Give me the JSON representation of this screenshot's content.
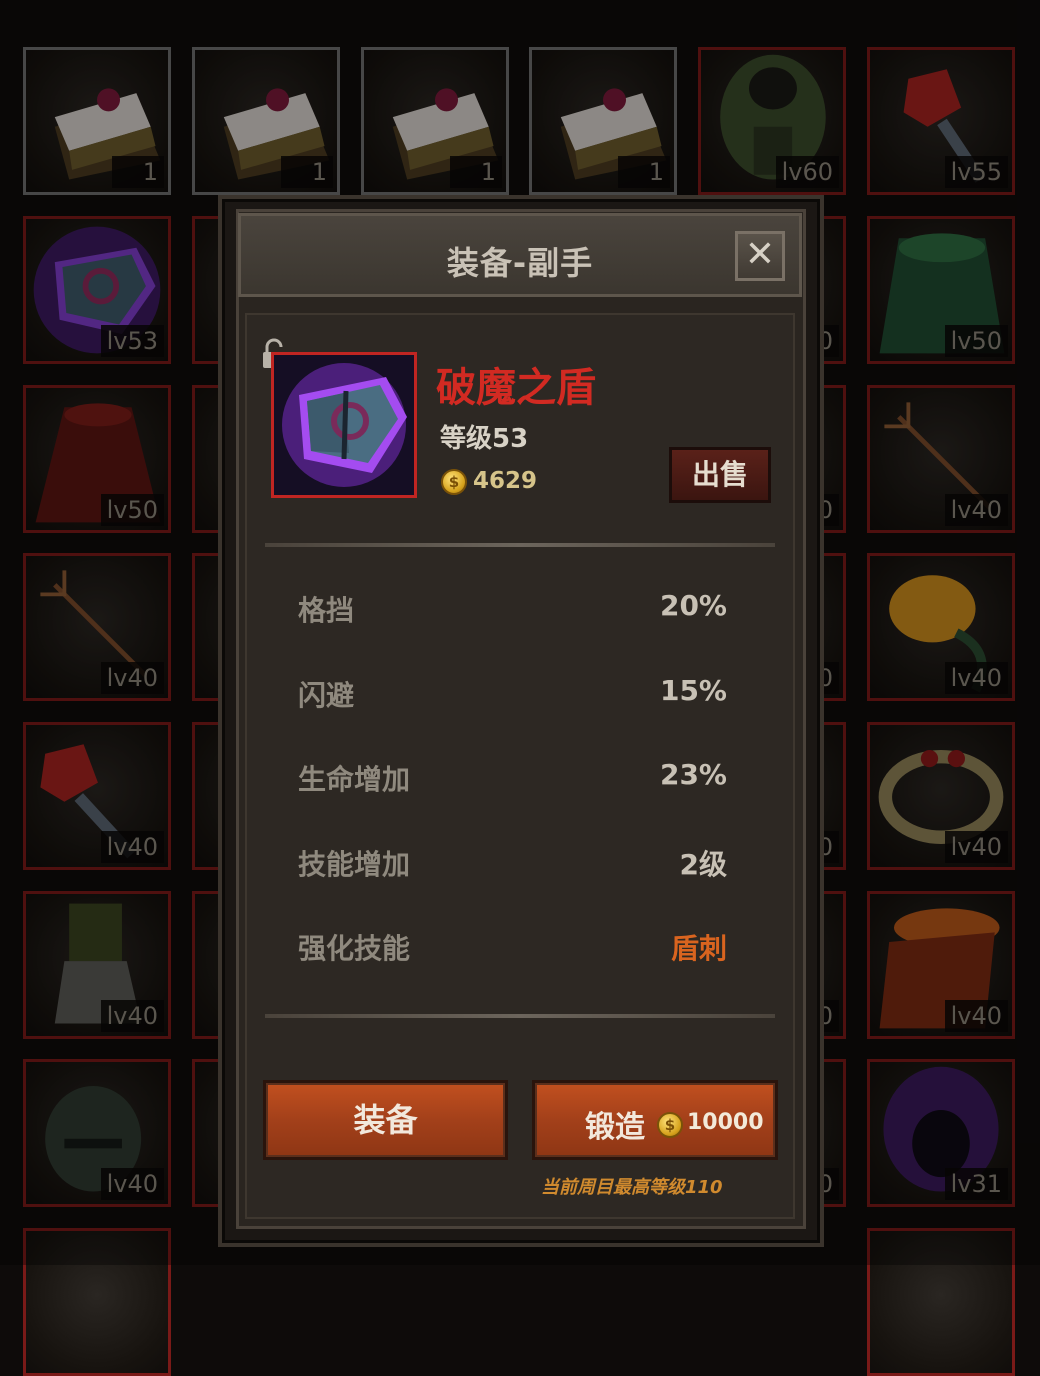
{
  "inventory": {
    "row1": [
      {
        "label": "1",
        "icon": "cake-icon"
      },
      {
        "label": "1",
        "icon": "cake-icon"
      },
      {
        "label": "1",
        "icon": "cake-icon"
      },
      {
        "label": "1",
        "icon": "cake-icon"
      },
      {
        "label": "lv60",
        "icon": "armor-icon"
      },
      {
        "label": "lv55",
        "icon": "ruby-scepter-icon"
      }
    ],
    "left_column": [
      {
        "label": "lv53",
        "icon": "shield-icon"
      },
      {
        "label": "lv50",
        "icon": "cloak-icon"
      },
      {
        "label": "lv40",
        "icon": "trident-icon"
      },
      {
        "label": "lv40",
        "icon": "ruby-scepter-icon"
      },
      {
        "label": "lv40",
        "icon": "greaves-icon"
      },
      {
        "label": "lv40",
        "icon": "helmet-icon"
      }
    ],
    "right_column": [
      {
        "label": "lv50",
        "icon": "green-cloak-icon"
      },
      {
        "label": "lv40",
        "icon": "trident-icon"
      },
      {
        "label": "lv40",
        "icon": "egg-icon"
      },
      {
        "label": "lv40",
        "icon": "ring-icon"
      },
      {
        "label": "lv40",
        "icon": "scarf-icon"
      },
      {
        "label": "lv31",
        "icon": "purple-hood-icon"
      }
    ],
    "peek_column": [
      {
        "label": "0"
      },
      {
        "label": "0"
      },
      {
        "label": "0"
      },
      {
        "label": "0"
      },
      {
        "label": "0"
      },
      {
        "label": "0"
      }
    ]
  },
  "modal": {
    "title": "装备-副手",
    "close_label": "✕",
    "item": {
      "name": "破魔之盾",
      "level": "等级53",
      "price": "4629",
      "name_color": "#d22a22"
    },
    "sell_label": "出售",
    "stats": [
      {
        "label": "格挡",
        "value": "20%"
      },
      {
        "label": "闪避",
        "value": "15%"
      },
      {
        "label": "生命增加",
        "value": "23%"
      },
      {
        "label": "技能增加",
        "value": "2级"
      },
      {
        "label": "强化技能",
        "value": "盾刺",
        "color": "#d9641f"
      }
    ],
    "equip_label": "装备",
    "forge_label": "锻造",
    "forge_cost": "10000",
    "cap_note": "当前周目最高等级110",
    "coin_symbol": "$"
  }
}
